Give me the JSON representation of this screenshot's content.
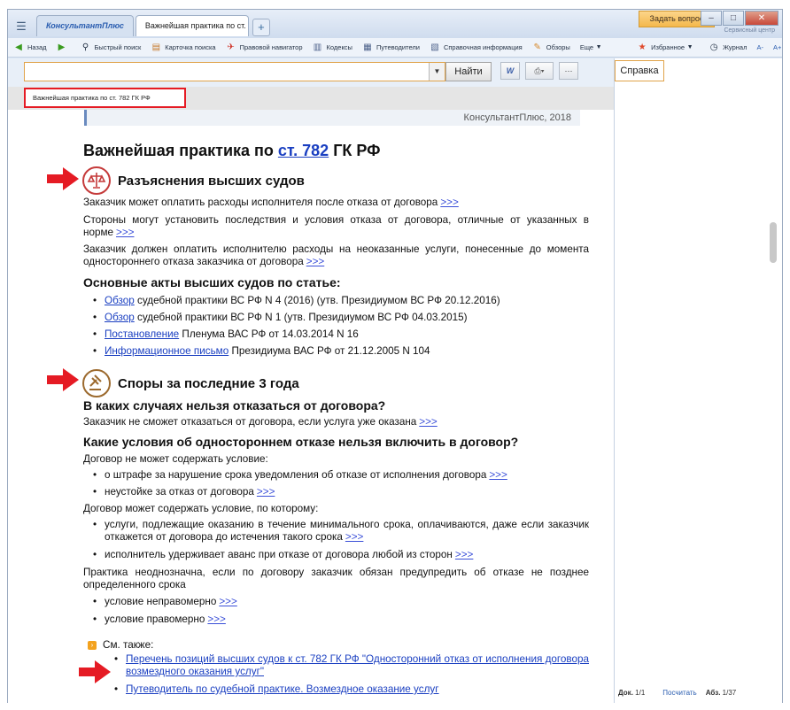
{
  "tabs": {
    "brand": "КонсультантПлюс",
    "active": "Важнейшая практика по ст. 782 ГК РФ"
  },
  "title_bar": {
    "ask_button": "Задать вопрос",
    "service_center": "Сервисный центр"
  },
  "toolbar": {
    "items": [
      {
        "label": "Назад",
        "icon": "back-arrow-icon"
      },
      {
        "label": "",
        "icon": "forward-arrow-icon"
      },
      {
        "label": "Быстрый поиск",
        "icon": "magnifier-icon"
      },
      {
        "label": "Карточка поиска",
        "icon": "search-card-icon"
      },
      {
        "label": "Правовой навигатор",
        "icon": "navigator-icon"
      },
      {
        "label": "Кодексы",
        "icon": "codex-icon"
      },
      {
        "label": "Путеводители",
        "icon": "guide-icon"
      },
      {
        "label": "Справочная информация",
        "icon": "reference-icon"
      },
      {
        "label": "Обзоры",
        "icon": "reviews-icon"
      },
      {
        "label": "Еще",
        "icon": "chevron-down-icon"
      }
    ],
    "right": [
      {
        "label": "Избранное",
        "icon": "star-icon"
      },
      {
        "label": "Журнал",
        "icon": "history-icon"
      },
      {
        "label": "A-",
        "icon": "font-smaller-icon"
      },
      {
        "label": "A+",
        "icon": "font-larger-icon"
      }
    ]
  },
  "search": {
    "value": "",
    "find_button": "Найти",
    "help_button": "Справка"
  },
  "breadcrumb": "Важнейшая практика по ст. 782 ГК РФ",
  "doc": {
    "source": "КонсультантПлюс, 2018",
    "title_prefix": "Важнейшая практика по ",
    "title_link": "ст. 782",
    "title_suffix": " ГК РФ",
    "section1": "Разъяснения высших судов",
    "s1_items": [
      "Заказчик может оплатить расходы исполнителя после отказа от договора",
      "Стороны могут установить последствия и условия отказа от договора, отличные от указанных в норме",
      "Заказчик должен оплатить исполнителю расходы на неоказанные услуги, понесенные до момента одностороннего отказа заказчика от договора"
    ],
    "more": ">>>",
    "acts_heading": "Основные акты высших судов по статье:",
    "acts": [
      {
        "link": "Обзор",
        "text": " судебной практики ВС РФ N 4 (2016) (утв. Президиумом ВС РФ 20.12.2016)"
      },
      {
        "link": "Обзор",
        "text": " судебной практики ВС РФ N 1 (утв. Президиумом ВС РФ 04.03.2015)"
      },
      {
        "link": "Постановление",
        "text": " Пленума ВАС РФ от 14.03.2014 N 16"
      },
      {
        "link": "Информационное письмо",
        "text": " Президиума ВАС РФ от 21.12.2005 N 104"
      }
    ],
    "section2": "Споры за последние 3 года",
    "q1": "В каких случаях нельзя отказаться от договора?",
    "q1_text": "Заказчик не сможет отказаться от договора, если услуга уже оказана",
    "q2": "Какие условия об одностороннем отказе нельзя включить в договор?",
    "cannot": "Договор не может содержать условие:",
    "cannot_items": [
      "о штрафе за нарушение срока уведомления об отказе от исполнения договора",
      "неустойке за отказ от договора"
    ],
    "can": "Договор может содержать условие, по которому:",
    "can_items": [
      "услуги, подлежащие оказанию в течение минимального срока, оплачиваются, даже если заказчик откажется от договора до истечения такого срока",
      "исполнитель удерживает аванс при отказе от договора любой из сторон"
    ],
    "practice": "Практика неоднозначна, если по договору заказчик обязан предупредить об отказе не позднее определенного срока",
    "practice_items": [
      "условие неправомерно",
      "условие правомерно"
    ],
    "see_also": "См. также:",
    "see_links": [
      "Перечень позиций высших судов к ст. 782 ГК РФ \"Односторонний отказ от исполнения договора возмездного оказания услуг\"",
      "Путеводитель по судебной практике. Возмездное оказание услуг"
    ]
  },
  "status": {
    "doc_label": "Док.",
    "doc_value": "1/1",
    "count": "Посчитать",
    "abz_label": "Абз.",
    "abz_value": "1/37"
  },
  "colors": {
    "accent": "#e51b24",
    "link": "#1a3fc1",
    "highlight": "#f3a21e"
  }
}
